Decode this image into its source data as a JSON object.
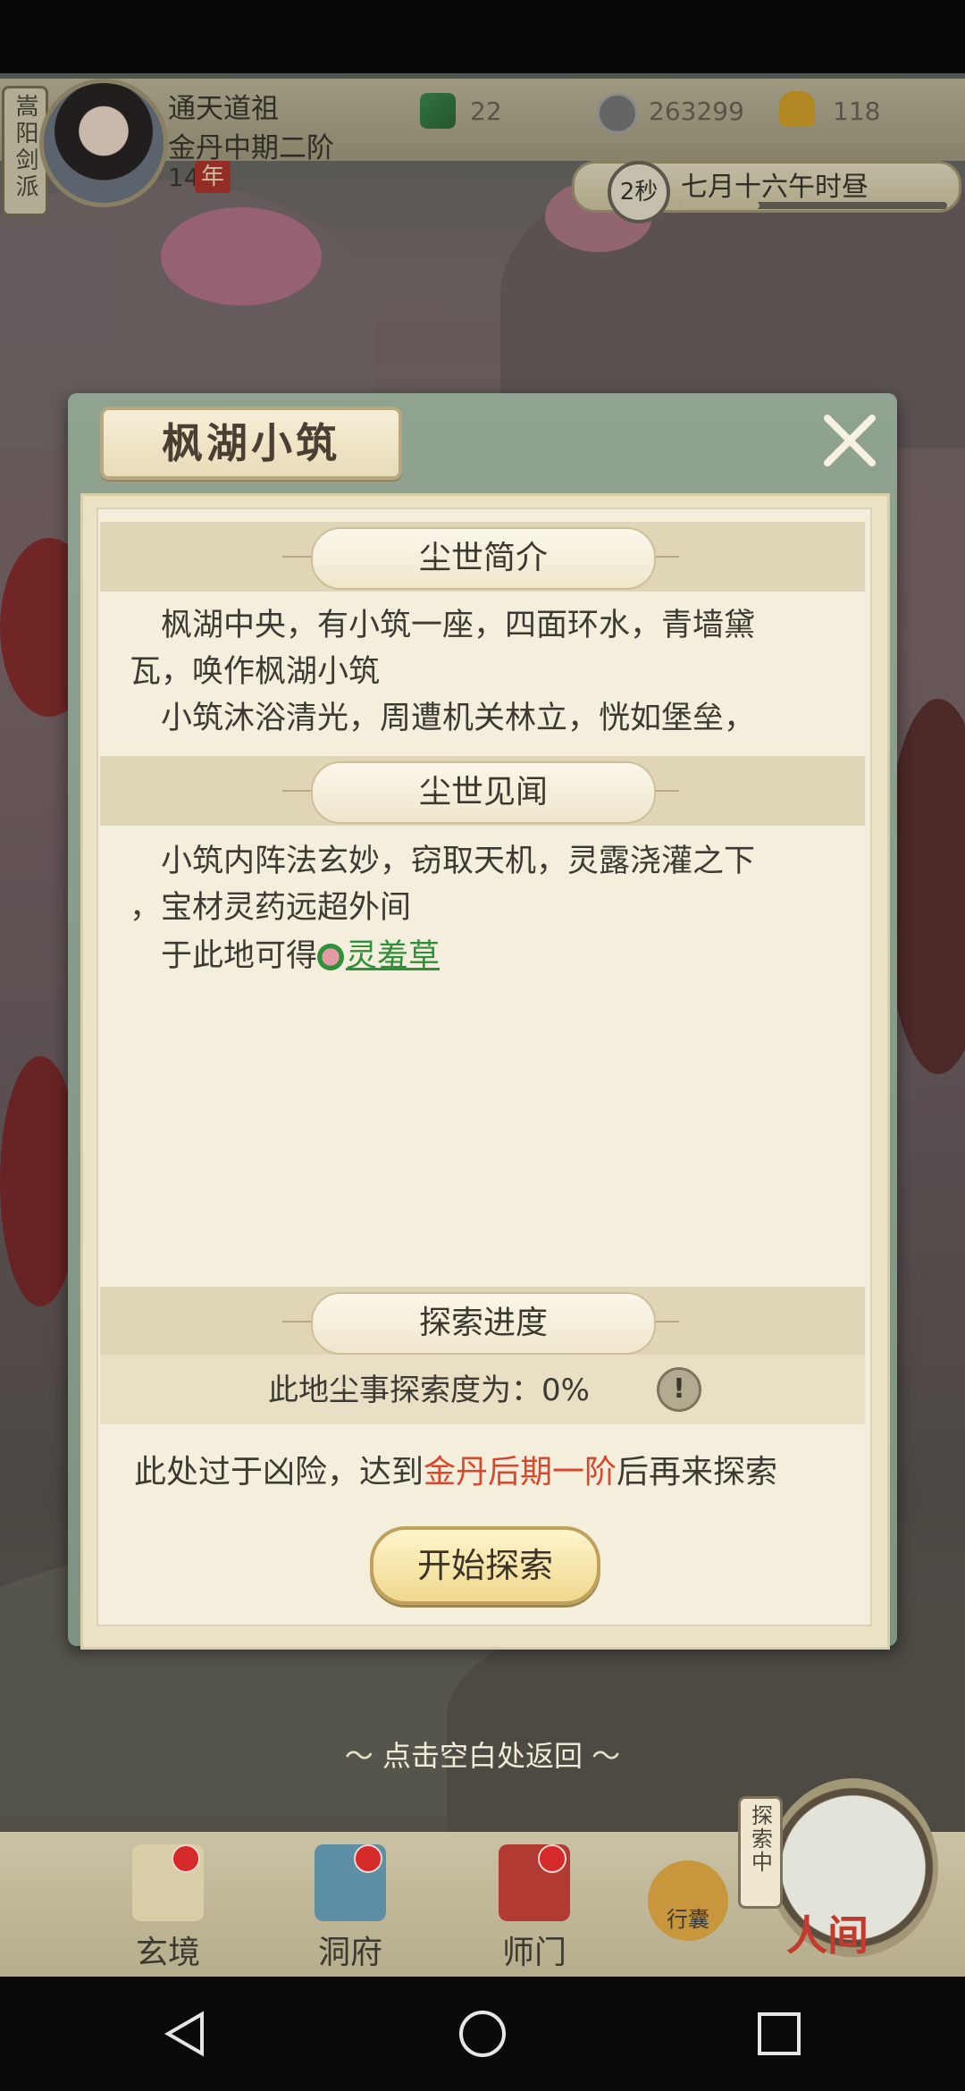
{
  "hud": {
    "sect": "嵩阳剑派",
    "player_name": "通天道祖",
    "realm": "金丹中期二阶",
    "age_value": "14",
    "age_unit": "年",
    "resources": [
      {
        "name": "jade-icon",
        "value": "22"
      },
      {
        "name": "coin-icon",
        "value": "263299"
      },
      {
        "name": "strength-icon",
        "value": "118"
      }
    ],
    "timer_seconds": "2秒",
    "game_date": "七月十六午时昼",
    "time_progress": 0.3
  },
  "modal": {
    "title": "枫湖小筑",
    "sections": {
      "intro_header": "尘世简介",
      "intro_lines": [
        "　枫湖中央，有小筑一座，四面环水，青墙黛",
        "瓦，唤作枫湖小筑",
        "　小筑沐浴清光，周遭机关林立，恍如堡垒，"
      ],
      "news_header": "尘世见闻",
      "news_lines": [
        "　小筑内阵法玄妙，窃取天机，灵露浇灌之下",
        "，宝材灵药远超外间"
      ],
      "obtain_prefix": "　于此地可得",
      "obtain_item": "灵羞草",
      "progress_header": "探索进度",
      "progress_text": "此地尘事探索度为：0%"
    },
    "danger_prefix": "此处过于凶险，达到",
    "danger_realm": "金丹后期一阶",
    "danger_suffix": "后再来探索",
    "start_button": "开始探索"
  },
  "back_hint": "点击空白处返回",
  "bottom_nav": {
    "items": [
      "玄境",
      "洞府",
      "师门",
      "行囊"
    ],
    "exploring_tag": "探索中",
    "world": "人间"
  },
  "colors": {
    "accent_red": "#d8482c",
    "link_green": "#2f8f3a",
    "modal_green": "#8fa390"
  }
}
